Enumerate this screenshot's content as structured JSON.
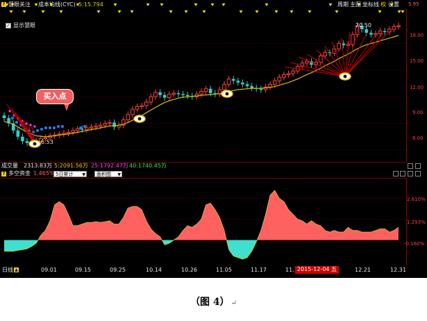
{
  "header": {
    "badge": "?",
    "indicator_name": "慧眼关注",
    "ma_label": "成本均线(CYC)",
    "ma_value": "5:15.794",
    "menu": [
      "周期",
      "主图",
      "坐标线",
      "权",
      "设置"
    ],
    "toggle_label": "显示慧眼",
    "toggle_checked": true,
    "top_right_value": "5.95"
  },
  "price_panel": {
    "axis_labels": [
      "18.00",
      "15.00",
      "12.00",
      "9.00",
      "6.00"
    ],
    "low_label": "6.53",
    "high_label": "20.50",
    "buy_callout": "买入点"
  },
  "volume_bar": {
    "label": "成交量",
    "total": "2313.83万",
    "ma5": "5:2091.56万",
    "ma25": "25:1792.47万",
    "ma40": "40:1740.45万"
  },
  "flow_panel": {
    "badge": "?",
    "name": "多空资金",
    "value": "1.465%",
    "select_period": "5日累计",
    "select_type": "面积图",
    "axis_labels": [
      "2.610%",
      "1.293%",
      "-0.160%"
    ]
  },
  "date_axis": {
    "left_label": "日线",
    "labels": [
      "09.01",
      "09.15",
      "09.25",
      "10.14",
      "10.26",
      "11.05",
      "11.17",
      "11.",
      "12.21",
      "12.31"
    ],
    "highlight": "2015-12-04 五"
  },
  "caption": {
    "text": "（图 4）",
    "return_mark": "↵"
  },
  "colors": {
    "up": "#ff4040",
    "down": "#30d0d0",
    "ma_line": "#d8c000",
    "flow_pos": "#ff6060",
    "flow_neg": "#40e0d0",
    "panel_bg": "#000000",
    "highlight_bg": "#d00000"
  },
  "chart_data": [
    {
      "type": "candlestick",
      "title": "慧眼关注",
      "x": [
        "08.24",
        "08.25",
        "08.26",
        "08.27",
        "08.28",
        "08.31",
        "09.01",
        "09.02",
        "09.07",
        "09.08",
        "09.09",
        "09.10",
        "09.11",
        "09.14",
        "09.15",
        "09.16",
        "09.17",
        "09.18",
        "09.21",
        "09.22",
        "09.23",
        "09.24",
        "09.25",
        "09.28",
        "09.29",
        "09.30",
        "10.08",
        "10.09",
        "10.12",
        "10.13",
        "10.14",
        "10.15",
        "10.16",
        "10.19",
        "10.20",
        "10.21",
        "10.22",
        "10.23",
        "10.26",
        "10.27",
        "10.28",
        "10.29",
        "10.30",
        "11.02",
        "11.03",
        "11.04",
        "11.05",
        "11.06",
        "11.09",
        "11.10",
        "11.11",
        "11.12",
        "11.13",
        "11.16",
        "11.17",
        "11.18",
        "11.19",
        "11.20",
        "11.23",
        "11.24",
        "11.25",
        "11.26",
        "11.27",
        "11.30",
        "12.01",
        "12.02",
        "12.03",
        "12.04",
        "12.07",
        "12.08",
        "12.09",
        "12.10",
        "12.11",
        "12.14",
        "12.15",
        "12.16",
        "12.17",
        "12.18",
        "12.21",
        "12.22",
        "12.23",
        "12.24",
        "12.25",
        "12.28",
        "12.29",
        "12.30",
        "12.31"
      ],
      "close": [
        9.6,
        9.0,
        8.2,
        7.5,
        7.0,
        6.8,
        6.7,
        7.0,
        7.3,
        7.4,
        7.6,
        7.7,
        7.8,
        7.9,
        8.0,
        8.2,
        8.4,
        8.3,
        8.5,
        8.6,
        8.7,
        8.8,
        9.0,
        9.1,
        8.6,
        8.8,
        9.4,
        10.0,
        10.6,
        10.9,
        11.0,
        11.4,
        12.0,
        12.5,
        12.2,
        11.9,
        12.3,
        12.4,
        12.3,
        12.2,
        12.1,
        12.0,
        12.3,
        12.6,
        12.9,
        12.4,
        12.3,
        12.8,
        13.4,
        14.0,
        13.8,
        13.6,
        13.4,
        13.2,
        13.0,
        12.9,
        12.8,
        13.1,
        13.4,
        13.8,
        14.2,
        14.5,
        14.6,
        14.9,
        15.4,
        15.8,
        16.0,
        15.6,
        15.9,
        16.6,
        17.0,
        16.9,
        17.4,
        18.0,
        17.8,
        17.9,
        19.0,
        20.0,
        19.6,
        19.2,
        19.0,
        19.1,
        19.4,
        19.3,
        19.6,
        19.9,
        20.0
      ],
      "ma": [
        9.2,
        9.1,
        8.9,
        8.6,
        8.3,
        8.0,
        7.8,
        7.6,
        7.55,
        7.5,
        7.55,
        7.6,
        7.7,
        7.75,
        7.8,
        7.9,
        8.0,
        8.1,
        8.2,
        8.3,
        8.4,
        8.5,
        8.6,
        8.7,
        8.75,
        8.8,
        8.9,
        9.1,
        9.35,
        9.6,
        9.9,
        10.2,
        10.5,
        10.8,
        11.1,
        11.35,
        11.55,
        11.7,
        11.85,
        11.95,
        12.0,
        12.05,
        12.1,
        12.15,
        12.2,
        12.25,
        12.3,
        12.35,
        12.45,
        12.6,
        12.7,
        12.8,
        12.85,
        12.9,
        12.95,
        12.95,
        12.95,
        13.0,
        13.05,
        13.15,
        13.3,
        13.45,
        13.6,
        13.8,
        14.0,
        14.25,
        14.5,
        14.7,
        14.95,
        15.2,
        15.5,
        15.75,
        16.0,
        16.3,
        16.55,
        16.8,
        17.1,
        17.4,
        17.65,
        17.85,
        18.0,
        18.15,
        18.3,
        18.45,
        18.6,
        18.75,
        18.9
      ],
      "ylim": [
        4.9,
        21.8
      ],
      "y_ticks": [
        18,
        15,
        12,
        9,
        6
      ],
      "low_annotation": 6.53,
      "high_annotation": 20.5
    },
    {
      "type": "area",
      "title": "多空资金",
      "x": [
        "08.24",
        "08.25",
        "08.26",
        "08.27",
        "08.28",
        "08.31",
        "09.01",
        "09.02",
        "09.07",
        "09.08",
        "09.09",
        "09.10",
        "09.11",
        "09.14",
        "09.15",
        "09.16",
        "09.17",
        "09.18",
        "09.21",
        "09.22",
        "09.23",
        "09.24",
        "09.25",
        "09.28",
        "09.29",
        "09.30",
        "10.08",
        "10.09",
        "10.12",
        "10.13",
        "10.14",
        "10.15",
        "10.16",
        "10.19",
        "10.20",
        "10.21",
        "10.22",
        "10.23",
        "10.26",
        "10.27",
        "10.28",
        "10.29",
        "10.30",
        "11.02",
        "11.03",
        "11.04",
        "11.05",
        "11.06",
        "11.09",
        "11.10",
        "11.11",
        "11.12",
        "11.13",
        "11.16",
        "11.17",
        "11.18",
        "11.19",
        "11.20",
        "11.23",
        "11.24",
        "11.25",
        "11.26",
        "11.27",
        "11.30",
        "12.01",
        "12.02",
        "12.03",
        "12.04",
        "12.07",
        "12.08",
        "12.09",
        "12.10",
        "12.11",
        "12.14",
        "12.15",
        "12.16",
        "12.17",
        "12.18",
        "12.21",
        "12.22",
        "12.23",
        "12.24",
        "12.25",
        "12.28",
        "12.29",
        "12.30",
        "12.31"
      ],
      "values": [
        -0.7,
        -0.7,
        -0.7,
        -0.65,
        -0.6,
        -0.55,
        -0.4,
        -0.2,
        0.3,
        0.6,
        1.2,
        2.2,
        2.4,
        2.2,
        1.6,
        0.9,
        0.9,
        1.0,
        1.1,
        1.1,
        1.15,
        1.1,
        1.15,
        1.2,
        1.0,
        1.0,
        1.4,
        2.0,
        2.1,
        2.1,
        1.9,
        1.2,
        0.7,
        0.4,
        0.2,
        -0.3,
        -0.2,
        0.0,
        0.2,
        0.6,
        0.9,
        0.8,
        1.0,
        1.3,
        2.2,
        2.3,
        1.9,
        1.4,
        0.6,
        -0.6,
        -1.0,
        -1.1,
        -1.2,
        -1.1,
        -0.7,
        -0.1,
        0.6,
        1.6,
        2.8,
        3.1,
        2.6,
        2.4,
        1.9,
        1.6,
        1.3,
        1.2,
        1.0,
        1.2,
        1.0,
        0.9,
        0.6,
        0.5,
        0.6,
        0.5,
        0.5,
        0.8,
        0.6,
        0.6,
        0.5,
        0.5,
        0.5,
        0.6,
        0.7,
        0.7,
        0.5,
        0.6,
        0.8
      ],
      "ylim": [
        -1.5,
        3.8
      ],
      "y_ticks": [
        2.61,
        1.293,
        -0.16
      ],
      "unit": "%"
    }
  ]
}
